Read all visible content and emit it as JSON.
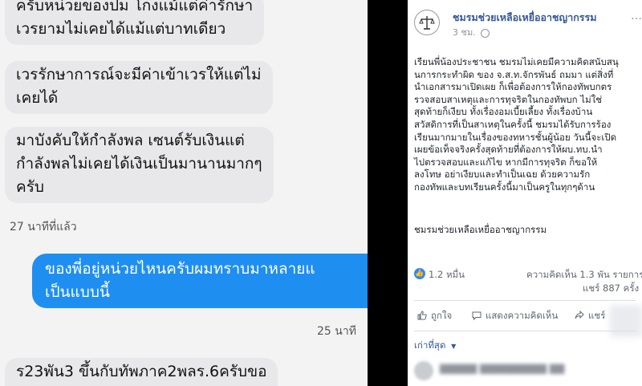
{
  "chat": {
    "messages": [
      {
        "direction": "in",
        "lines": [
          "ครับหน่วยของปม โกงแม้แต่ค่ารักษา",
          "เวรยามไม่เคยได้แม้แต่บาทเดียว"
        ]
      },
      {
        "direction": "in",
        "lines": [
          "เวรรักษาการณ์จะมีค่าเข้าเวรให้แต่ไม่",
          "เคยได้"
        ]
      },
      {
        "direction": "in",
        "lines": [
          "มาบังคับให้กำลังพล เซนต์รับเงินแต่",
          "กำลังพลไม่เคยได้เงินเป็นมานานมากๆ",
          "ครับ"
        ]
      },
      {
        "direction": "out",
        "lines": [
          "ของพี่อยู่หน่วยไหนครับผมทราบมาหลายแ",
          "เป็นแบบนี้"
        ]
      },
      {
        "direction": "in",
        "lines": [
          "ร23พัน3 ขึ้นกับทัพภาค2พลร.6ครับขอ"
        ]
      }
    ],
    "time_1": "27 นาทีที่แล้ว",
    "time_2": "25 นาที"
  },
  "post": {
    "page_name": "ชมรมช่วยเหลือเหยื่ออาชญากรรม",
    "timestamp": "3 ชม.",
    "body_lines": [
      "เรียนพี่น้องประชาชน ชมรมไม่เคยมีความคิดสนับสนุ",
      "นการกระทำผิด ของ จ.ส.ท.จักรพันธ์ ถมมา แต่สิ่งที่",
      "นำเอกสารมาเปิดเผย ก็เพื่อต้องการให้กองทัพบกตร",
      "รวจสอบสาเหตุและการทุจริตในกองทัพบก ไม่ใช่",
      "สุดท้ายก็เงียบ ทั้งเรื่องอมเบี้ยเลี้ยง ทั้งเรื่องบ้าน",
      "สวัสดิการที่เป็นสาเหตุในครั้งนี้ ชมรมได้รับการร้อง",
      "เรียนมากมายในเรื่องของทหารชั้นผู้น้อย วันนี้จะเปิด",
      "เผยข้อเท็จจริงครั้งสุดท้ายที่ต้องการให้ผบ.ทบ.นำ",
      "ไปตรวจสอบและแก้ไข หากมีการทุจริต ก็ขอให้",
      "ลงโทษ อย่าเงียบและทำเป็นเฉย ด้วยความรัก",
      "กองทัพและบทเรียนครั้งนี้มาเป็นครูในทุกๆด้าน"
    ],
    "signature": "ชมรมช่วยเหลือเหยื่ออาชญากรรม",
    "reactions_count": "1.2 หมื่น",
    "comments_count": "ความคิดเห็น 1.3 พัน รายการ",
    "shares_count": "แชร์ 887 ครั้ง",
    "actions": {
      "like": "ถูกใจ",
      "comment": "แสดงความคิดเห็น",
      "share": "แชร์"
    },
    "sort_label": "เก่าที่สุด",
    "colors": {
      "link": "#365899",
      "like_blue": "#2d88ff",
      "messenger_blue": "#1f8ef1"
    }
  }
}
